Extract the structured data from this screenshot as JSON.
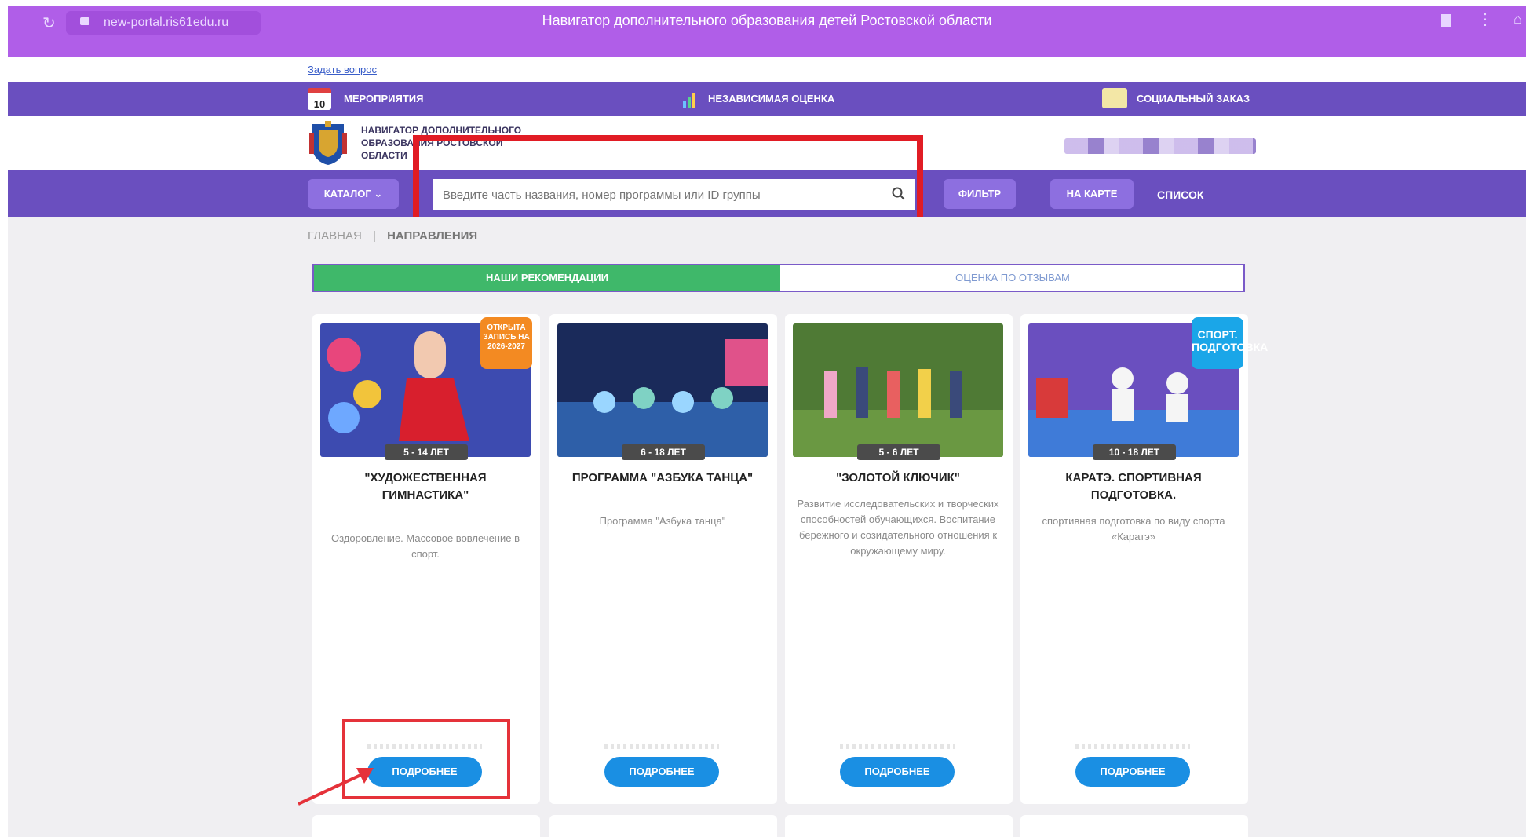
{
  "browser": {
    "url": "new-portal.ris61edu.ru",
    "page_title": "Навигатор дополнительного образования детей Ростовской области"
  },
  "ask": {
    "label": "Задать вопрос"
  },
  "topnav": {
    "events_badge": "10",
    "events_label": "МЕРОПРИЯТИЯ",
    "assessment_label": "НЕЗАВИСИМАЯ ОЦЕНКА",
    "social_label": "СОЦИАЛЬНЫЙ ЗАКАЗ"
  },
  "brand": {
    "line1": "НАВИГАТОР ДОПОЛНИТЕЛЬНОГО",
    "line2": "ОБРАЗОВАНИЯ РОСТОВСКОЙ",
    "line3": "ОБЛАСТИ"
  },
  "search": {
    "catalog_label": "КАТАЛОГ",
    "placeholder": "Введите часть названия, номер программы или ID группы",
    "filter_label": "ФИЛЬТР",
    "map_label": "НА КАРТЕ",
    "list_label": "СПИСОК"
  },
  "breadcrumb": {
    "home": "ГЛАВНАЯ",
    "separator": "|",
    "current": "НАПРАВЛЕНИЯ"
  },
  "tabs": [
    {
      "label": "НАШИ РЕКОМЕНДАЦИИ"
    },
    {
      "label": "ОЦЕНКА ПО ОТЗЫВАМ"
    }
  ],
  "cards": [
    {
      "age": "5 - 14 ЛЕТ",
      "title": "\"ХУДОЖЕСТВЕННАЯ ГИМНАСТИКА\"",
      "desc": "Оздоровление. Массовое вовлечение в спорт.",
      "badge": "ОТКРЫТА ЗАПИСЬ НА 2026-2027",
      "button": "ПОДРОБНЕЕ"
    },
    {
      "age": "6 - 18 ЛЕТ",
      "title": "ПРОГРАММА \"АЗБУКА ТАНЦА\"",
      "desc": "Программа \"Азбука танца\"",
      "button": "ПОДРОБНЕЕ"
    },
    {
      "age": "5 - 6 ЛЕТ",
      "title": "\"ЗОЛОТОЙ КЛЮЧИК\"",
      "desc": "Развитие исследовательских и творческих способностей обучающихся. Воспитание бережного и созидательного отношения к окружающему миру.",
      "button": "ПОДРОБНЕЕ"
    },
    {
      "age": "10 - 18 ЛЕТ",
      "title": "КАРАТЭ. СПОРТИВНАЯ ПОДГОТОВКА.",
      "desc": "спортивная подготовка по виду спорта «Каратэ»",
      "badge": "СПОРТ. ПОДГОТОВКА",
      "button": "ПОДРОБНЕЕ"
    }
  ],
  "colors": {
    "browser": "#b05ee8",
    "nav": "#6a4fbf",
    "active_tab": "#3fb86a",
    "button": "#1a8fe3",
    "highlight": "#e11c24"
  }
}
